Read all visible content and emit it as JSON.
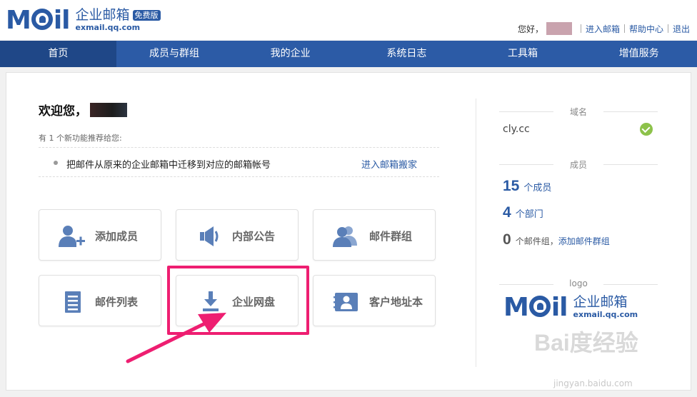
{
  "brand": {
    "logo_text": "MOil",
    "name_cn": "企业邮箱",
    "badge": "免费版",
    "url": "exmail.qq.com",
    "color": "#2a5aa4"
  },
  "toplinks": {
    "greeting": "您好，",
    "enter_mailbox": "进入邮箱",
    "help": "帮助中心",
    "logout": "退出"
  },
  "nav": {
    "items": [
      {
        "label": "首页",
        "active": true
      },
      {
        "label": "成员与群组",
        "active": false
      },
      {
        "label": "我的企业",
        "active": false
      },
      {
        "label": "系统日志",
        "active": false
      },
      {
        "label": "工具箱",
        "active": false
      },
      {
        "label": "增值服务",
        "active": false
      }
    ],
    "color": "#2c5ba6",
    "active_color": "#1f4787"
  },
  "main": {
    "welcome": "欢迎您，",
    "recommend_note": "有 1 个新功能推荐给您:",
    "recommendation": {
      "text": "把邮件从原来的企业邮箱中迁移到对应的邮箱帐号",
      "link": "进入邮箱搬家"
    },
    "tiles": [
      {
        "label": "添加成员",
        "icon": "add-user-icon"
      },
      {
        "label": "内部公告",
        "icon": "speaker-icon"
      },
      {
        "label": "邮件群组",
        "icon": "group-icon"
      },
      {
        "label": "邮件列表",
        "icon": "list-icon"
      },
      {
        "label": "企业网盘",
        "icon": "download-icon"
      },
      {
        "label": "客户地址本",
        "icon": "contact-card-icon"
      }
    ],
    "highlight_color": "#ee1e71"
  },
  "sidebar": {
    "domain_heading": "域名",
    "domain_value": "cly.cc",
    "members_heading": "成员",
    "members": {
      "count": "15",
      "unit": "个成员"
    },
    "departments": {
      "count": "4",
      "unit": "个部门"
    },
    "groups": {
      "count": "0",
      "unit": "个邮件组，",
      "link": "添加邮件群组"
    },
    "logo_heading": "logo"
  },
  "watermark": {
    "text": "Bai度经验",
    "url": "jingyan.baidu.com"
  }
}
